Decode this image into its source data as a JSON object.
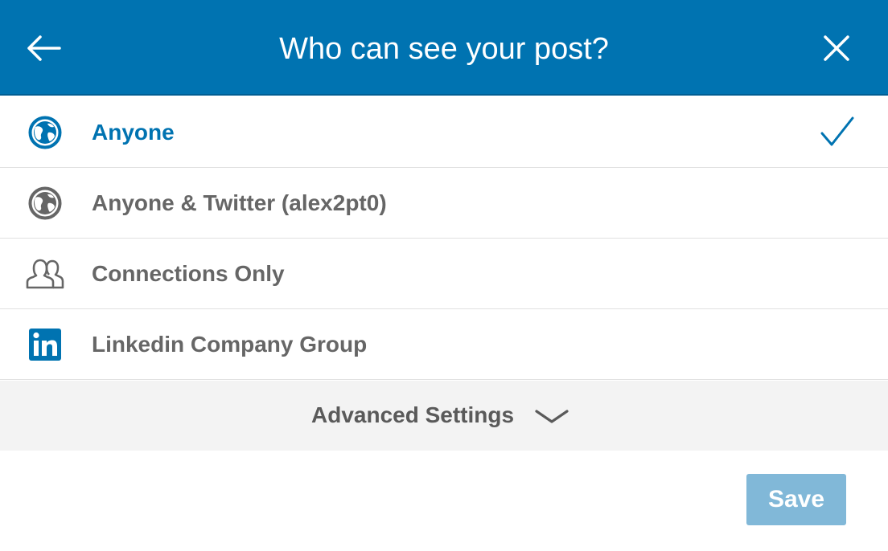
{
  "header": {
    "title": "Who can see your post?",
    "back_icon": "arrow-left-icon",
    "close_icon": "close-icon",
    "background": "#0073b1"
  },
  "options": [
    {
      "label": "Anyone",
      "icon": "globe-icon",
      "selected": true
    },
    {
      "label": "Anyone & Twitter (alex2pt0)",
      "icon": "globe-icon",
      "selected": false
    },
    {
      "label": "Connections Only",
      "icon": "people-icon",
      "selected": false
    },
    {
      "label": "Linkedin Company Group",
      "icon": "linkedin-icon",
      "selected": false
    }
  ],
  "advanced": {
    "label": "Advanced Settings",
    "icon": "chevron-down-icon"
  },
  "save": {
    "label": "Save",
    "enabled": false
  },
  "colors": {
    "accent": "#0073b1",
    "text": "#666666",
    "advanced_bg": "#f3f3f3",
    "save_disabled_bg": "#81b8d8"
  }
}
